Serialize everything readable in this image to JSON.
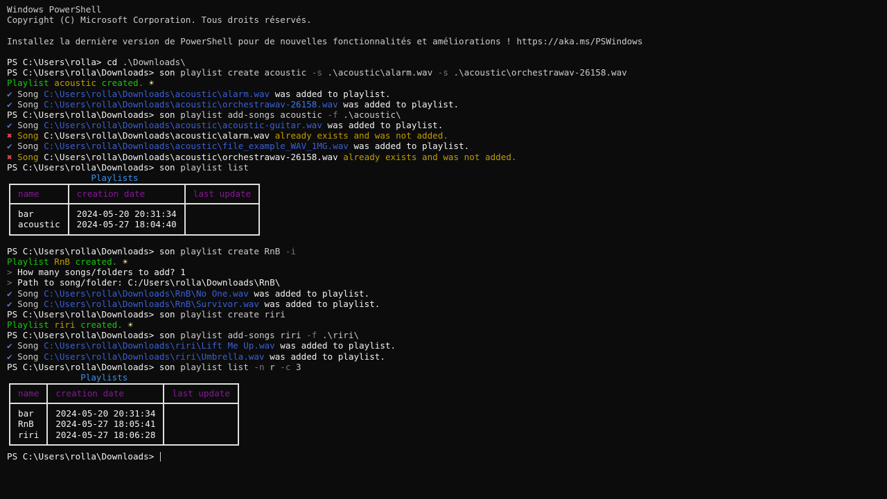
{
  "header": [
    "Windows PowerShell",
    "Copyright (C) Microsoft Corporation. Tous droits réservés.",
    "",
    "Installez la dernière version de PowerShell pour de nouvelles fonctionnalités et améliorations ! https://aka.ms/PSWindows",
    ""
  ],
  "block1": [
    [
      [
        "w",
        "PS C:\\Users\\rolla> "
      ],
      [
        "w",
        "cd"
      ],
      [
        "d",
        " .\\Downloads\\"
      ]
    ],
    [
      [
        "w",
        "PS C:\\Users\\rolla\\Downloads> "
      ],
      [
        "w",
        "son"
      ],
      [
        "d",
        " playlist create acoustic "
      ],
      [
        "gr",
        "-s"
      ],
      [
        "d",
        " .\\acoustic\\alarm.wav "
      ],
      [
        "gr",
        "-s"
      ],
      [
        "d",
        " .\\acoustic\\orchestrawav-26158.wav"
      ]
    ],
    [
      [
        "gb",
        "Playlist "
      ],
      [
        "y",
        "acoustic"
      ],
      [
        "gb",
        " created. "
      ],
      [
        "sun",
        "☀"
      ]
    ],
    [
      [
        "ok",
        "✔ "
      ],
      [
        "d",
        "Song "
      ],
      [
        "b",
        "C:\\Users\\rolla\\Downloads\\acoustic\\alarm.wav"
      ],
      [
        "w",
        " was added to playlist."
      ]
    ],
    [
      [
        "ok",
        "✔ "
      ],
      [
        "d",
        "Song "
      ],
      [
        "b",
        "C:\\Users\\rolla\\Downloads\\acoustic\\orchestrawav-"
      ],
      [
        "bb",
        "26158"
      ],
      [
        "b",
        ".wav"
      ],
      [
        "w",
        " was added to playlist."
      ]
    ],
    [
      [
        "w",
        "PS C:\\Users\\rolla\\Downloads> "
      ],
      [
        "w",
        "son"
      ],
      [
        "d",
        " playlist add-songs acoustic "
      ],
      [
        "gr",
        "-f"
      ],
      [
        "d",
        " .\\acoustic\\"
      ]
    ],
    [
      [
        "ok",
        "✔ "
      ],
      [
        "d",
        "Song "
      ],
      [
        "b",
        "C:\\Users\\rolla\\Downloads\\acoustic\\acoustic-guitar.wav"
      ],
      [
        "w",
        " was added to playlist."
      ]
    ],
    [
      [
        "x",
        "✖ "
      ],
      [
        "y",
        "Song "
      ],
      [
        "w",
        "C:\\Users\\rolla\\Downloads\\acoustic\\alarm.wav"
      ],
      [
        "y",
        " already exists and was not added."
      ]
    ],
    [
      [
        "ok",
        "✔ "
      ],
      [
        "d",
        "Song "
      ],
      [
        "b",
        "C:\\Users\\rolla\\Downloads\\acoustic\\file_example_WAV_1MG.wav"
      ],
      [
        "w",
        " was added to playlist."
      ]
    ],
    [
      [
        "x",
        "✖ "
      ],
      [
        "y",
        "Song "
      ],
      [
        "w",
        "C:\\Users\\rolla\\Downloads\\acoustic\\orchestrawav-26158.wav"
      ],
      [
        "y",
        " already exists and was not added."
      ]
    ],
    [
      [
        "w",
        "PS C:\\Users\\rolla\\Downloads> "
      ],
      [
        "w",
        "son"
      ],
      [
        "d",
        " playlist list"
      ]
    ]
  ],
  "table1": {
    "title": "                Playlists",
    "headers": [
      "name",
      "creation date",
      "last update"
    ],
    "col_name": "bar\nacoustic",
    "col_date": "2024-05-20 20:31:34\n2024-05-27 18:04:40",
    "col_update": ""
  },
  "block2": [
    [
      [
        "w",
        "PS C:\\Users\\rolla\\Downloads> "
      ],
      [
        "w",
        "son"
      ],
      [
        "d",
        " playlist create RnB "
      ],
      [
        "gr",
        "-i"
      ]
    ],
    [
      [
        "gb",
        "Playlist "
      ],
      [
        "y",
        "RnB"
      ],
      [
        "gb",
        " created. "
      ],
      [
        "sun",
        "☀"
      ]
    ],
    [
      [
        "gr",
        "> "
      ],
      [
        "w",
        "How many songs/folders to add? 1"
      ]
    ],
    [
      [
        "gr",
        "> "
      ],
      [
        "w",
        "Path to song/folder: C:/Users\\rolla\\Downloads\\RnB\\"
      ]
    ],
    [
      [
        "ok",
        "✔ "
      ],
      [
        "d",
        "Song "
      ],
      [
        "b",
        "C:\\Users\\rolla\\Downloads\\RnB\\No One.wav"
      ],
      [
        "w",
        " was added to playlist."
      ]
    ],
    [
      [
        "ok",
        "✔ "
      ],
      [
        "d",
        "Song "
      ],
      [
        "b",
        "C:\\Users\\rolla\\Downloads\\RnB\\Survivor.wav"
      ],
      [
        "w",
        " was added to playlist."
      ]
    ],
    [
      [
        "w",
        "PS C:\\Users\\rolla\\Downloads> "
      ],
      [
        "w",
        "son"
      ],
      [
        "d",
        " playlist create riri"
      ]
    ],
    [
      [
        "gb",
        "Playlist "
      ],
      [
        "y",
        "riri"
      ],
      [
        "gb",
        " created. "
      ],
      [
        "sun",
        "☀"
      ]
    ],
    [
      [
        "w",
        "PS C:\\Users\\rolla\\Downloads> "
      ],
      [
        "w",
        "son"
      ],
      [
        "d",
        " playlist add-songs riri "
      ],
      [
        "gr",
        "-f"
      ],
      [
        "d",
        " .\\riri\\"
      ]
    ],
    [
      [
        "ok",
        "✔ "
      ],
      [
        "d",
        "Song "
      ],
      [
        "b",
        "C:\\Users\\rolla\\Downloads\\riri\\Lift Me Up.wav"
      ],
      [
        "w",
        " was added to playlist."
      ]
    ],
    [
      [
        "ok",
        "✔ "
      ],
      [
        "d",
        "Song "
      ],
      [
        "b",
        "C:\\Users\\rolla\\Downloads\\riri\\Umbrella.wav"
      ],
      [
        "w",
        " was added to playlist."
      ]
    ],
    [
      [
        "w",
        "PS C:\\Users\\rolla\\Downloads> "
      ],
      [
        "w",
        "son"
      ],
      [
        "d",
        " playlist list "
      ],
      [
        "gr",
        "-n"
      ],
      [
        "d",
        " r "
      ],
      [
        "gr",
        "-c"
      ],
      [
        "d",
        " 3"
      ]
    ]
  ],
  "table2": {
    "title": "              Playlists",
    "headers": [
      "name",
      "creation date",
      "last update"
    ],
    "col_name": "bar\nRnB\nriri",
    "col_date": "2024-05-20 20:31:34\n2024-05-27 18:05:41\n2024-05-27 18:06:28",
    "col_update": ""
  },
  "prompt": "PS C:\\Users\\rolla\\Downloads> "
}
